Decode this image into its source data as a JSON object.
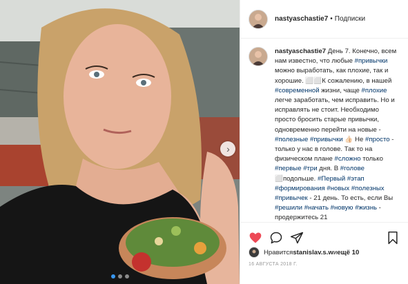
{
  "header": {
    "username": "nastyaschastie7",
    "separator": "•",
    "follow_label": "Подписки"
  },
  "caption": {
    "username": "nastyaschastie7",
    "segments": [
      {
        "t": "text",
        "v": " День 7. Конечно, всем нам известно, что любые "
      },
      {
        "t": "tag",
        "v": "#привычки"
      },
      {
        "t": "text",
        "v": " можно выработать, как плохие, так и хорошие. ⬜⬜К сожалению, в нашей "
      },
      {
        "t": "tag",
        "v": "#современной"
      },
      {
        "t": "text",
        "v": " жизни, чаще "
      },
      {
        "t": "tag",
        "v": "#плохие"
      },
      {
        "t": "text",
        "v": " легче заработать, чем исправить. Но и исправлять не стоит. Необходимо просто бросить старые привычки, одновременно перейти на новые - "
      },
      {
        "t": "tag",
        "v": "#полезные"
      },
      {
        "t": "text",
        "v": " "
      },
      {
        "t": "tag",
        "v": "#привычки"
      },
      {
        "t": "text",
        "v": " 👍🏻 Не "
      },
      {
        "t": "tag",
        "v": "#просто"
      },
      {
        "t": "text",
        "v": " - только у нас в голове. Так то на физическом плане "
      },
      {
        "t": "tag",
        "v": "#сложно"
      },
      {
        "t": "text",
        "v": " только "
      },
      {
        "t": "tag",
        "v": "#первые"
      },
      {
        "t": "text",
        "v": " "
      },
      {
        "t": "tag",
        "v": "#три"
      },
      {
        "t": "text",
        "v": " дня. В "
      },
      {
        "t": "tag",
        "v": "#голове"
      },
      {
        "t": "text",
        "v": " ⬜подольше. "
      },
      {
        "t": "tag",
        "v": "#Первый"
      },
      {
        "t": "text",
        "v": " "
      },
      {
        "t": "tag",
        "v": "#этап"
      },
      {
        "t": "text",
        "v": " "
      },
      {
        "t": "tag",
        "v": "#формирования"
      },
      {
        "t": "text",
        "v": " "
      },
      {
        "t": "tag",
        "v": "#новых"
      },
      {
        "t": "text",
        "v": " "
      },
      {
        "t": "tag",
        "v": "#полезных"
      },
      {
        "t": "text",
        "v": " "
      },
      {
        "t": "tag",
        "v": "#привычек"
      },
      {
        "t": "text",
        "v": " - 21 день. То есть, если Вы "
      },
      {
        "t": "tag",
        "v": "#решили"
      },
      {
        "t": "text",
        "v": " "
      },
      {
        "t": "tag",
        "v": "#начать"
      },
      {
        "t": "text",
        "v": " "
      },
      {
        "t": "tag",
        "v": "#новую"
      },
      {
        "t": "text",
        "v": " "
      },
      {
        "t": "tag",
        "v": "#жизнь"
      },
      {
        "t": "text",
        "v": " - продержитесь 21"
      }
    ]
  },
  "likes": {
    "prefix": "Нравится ",
    "user": "stanislav.s.w",
    "middle": " и ",
    "others": "ещё 10"
  },
  "date": "16 АВГУСТА 2018 Г.",
  "carousel": {
    "count": 3,
    "active": 0
  },
  "colors": {
    "like": "#ed4956",
    "tag": "#003569",
    "active_dot": "#3897f0"
  },
  "icons": {
    "like": "heart-icon",
    "comment": "comment-icon",
    "share": "share-icon",
    "save": "bookmark-icon",
    "next": "chevron-right-icon"
  }
}
